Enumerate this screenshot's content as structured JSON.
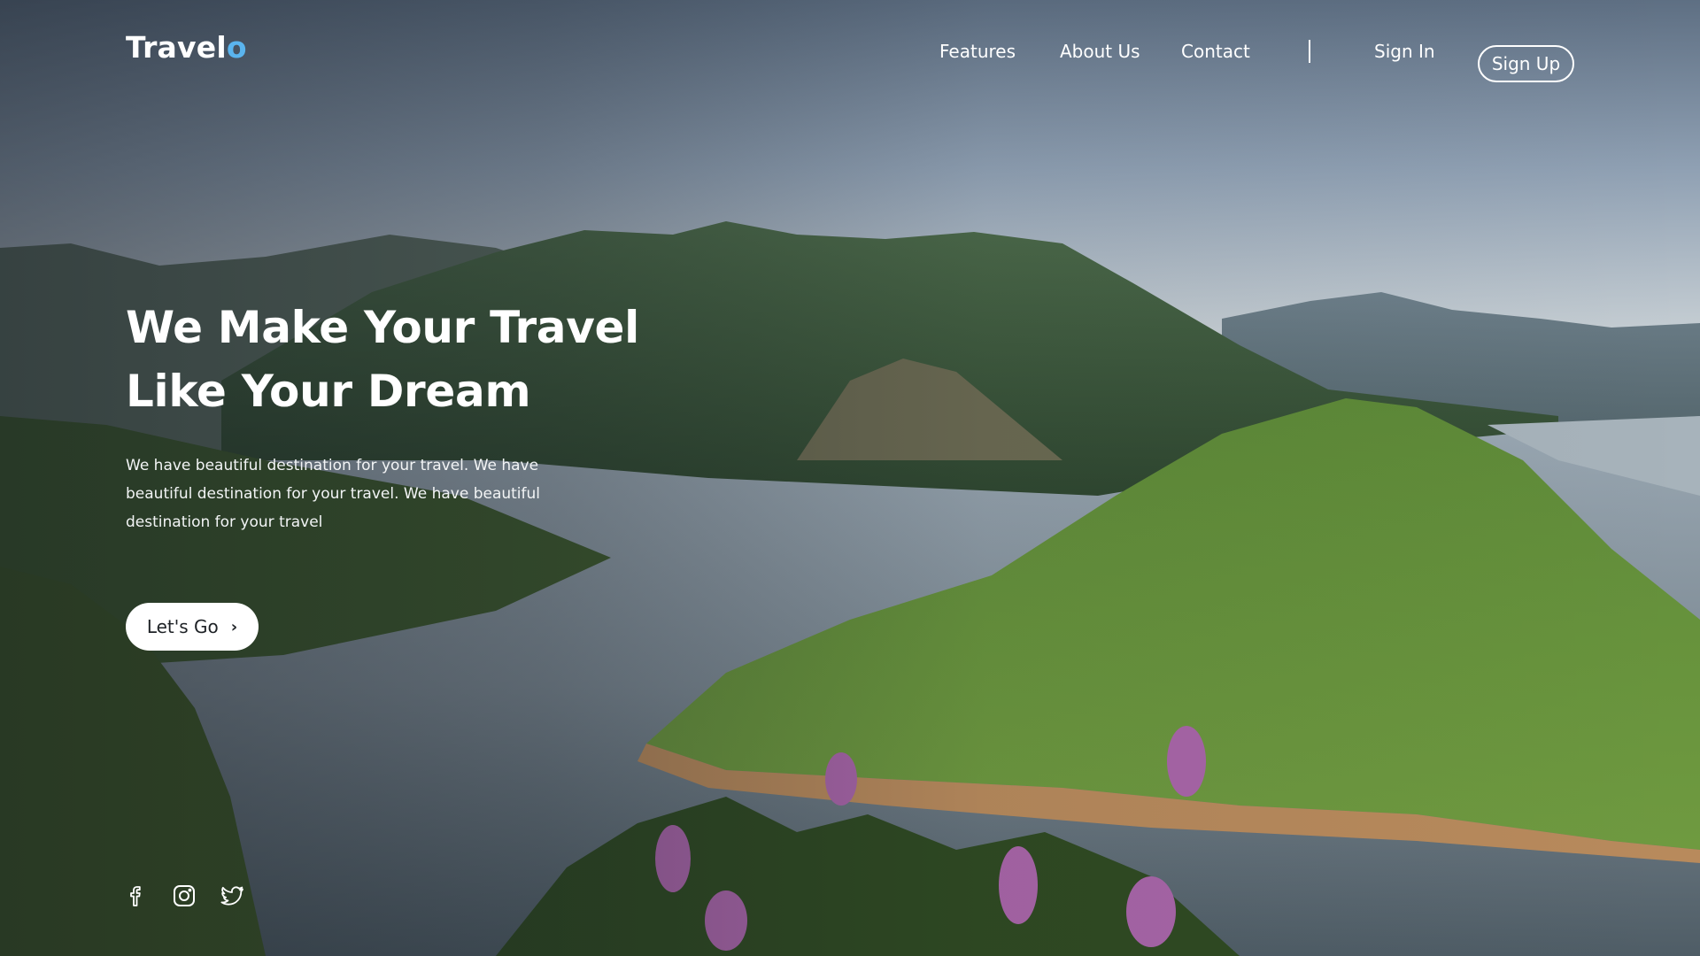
{
  "brand": {
    "name_main": "Travel",
    "name_accent": "o",
    "accent_color": "#5ab4ee"
  },
  "nav": {
    "links": [
      "Features",
      "About Us",
      "Contact"
    ],
    "signin_label": "Sign In",
    "signup_label": "Sign Up"
  },
  "hero": {
    "title_line1": "We Make Your Travel",
    "title_line2": "Like Your Dream",
    "description": "We have beautiful destination for your travel. We have beautiful destination for your travel. We have beautiful destination for your travel",
    "cta_label": "Let's Go",
    "cta_icon": "chevron-right-icon"
  },
  "social": [
    "facebook-icon",
    "instagram-icon",
    "twitter-icon"
  ]
}
